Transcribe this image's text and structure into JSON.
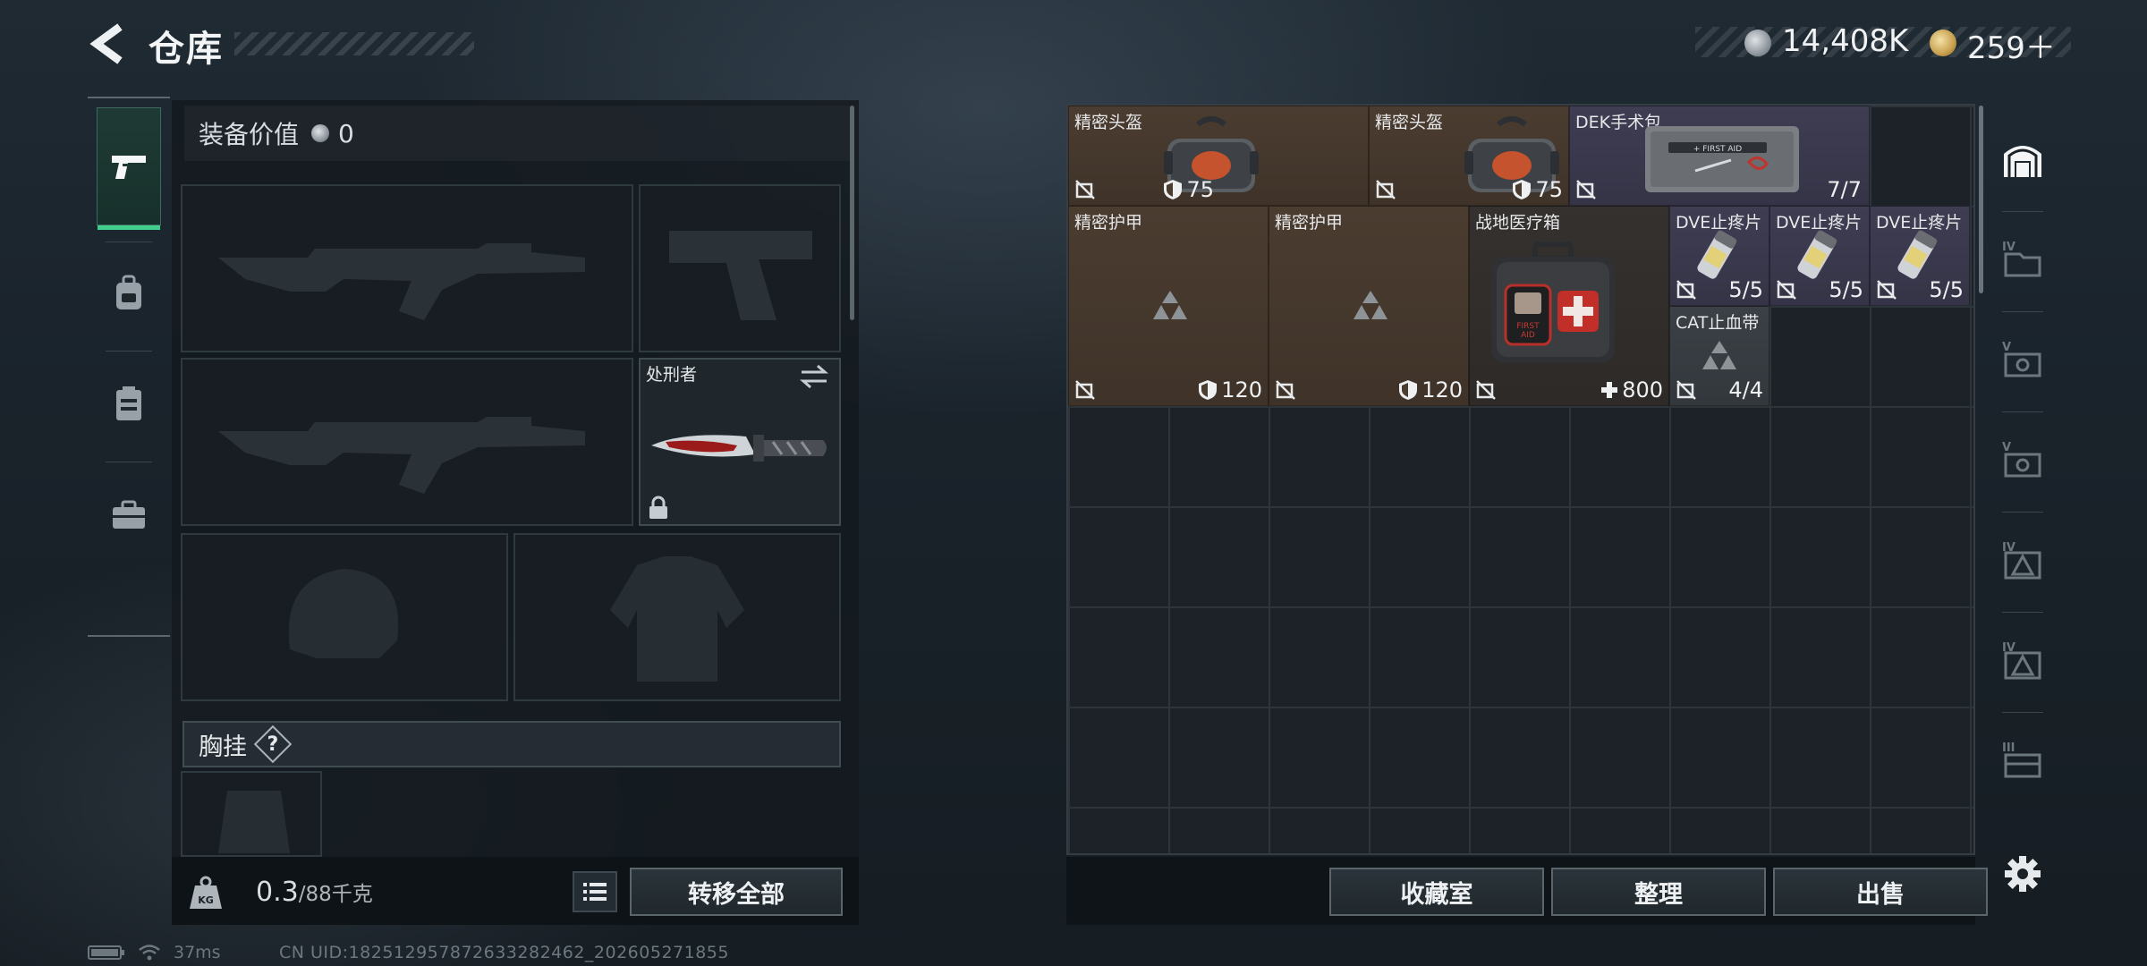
{
  "header": {
    "title": "仓库",
    "currency_silver": "14,408K",
    "currency_gold": "259＋"
  },
  "loadout": {
    "equip_value_label": "装备价值",
    "equip_value": "0",
    "knife_name": "处刑者",
    "chest_rig_label": "胸挂",
    "chest_rig_help": "?",
    "weight_current": "0.3",
    "weight_max": "/88千克",
    "transfer_all": "转移全部"
  },
  "stash": {
    "items": [
      {
        "name": "精密头盔",
        "stat": "75",
        "stat_icon": "shield-icon"
      },
      {
        "name": "精密头盔",
        "stat": "75",
        "stat_icon": "shield-icon"
      },
      {
        "name": "DEK手术包",
        "stat": "7/7"
      },
      {
        "name": "精密护甲",
        "stat": "120",
        "stat_icon": "shield-icon"
      },
      {
        "name": "精密护甲",
        "stat": "120",
        "stat_icon": "shield-icon"
      },
      {
        "name": "战地医疗箱",
        "stat": "800",
        "stat_icon": "plus-icon"
      },
      {
        "name": "DVE止疼片",
        "stat": "5/5"
      },
      {
        "name": "DVE止疼片",
        "stat": "5/5"
      },
      {
        "name": "DVE止疼片",
        "stat": "5/5"
      },
      {
        "name": "CAT止血带",
        "stat": "4/4"
      }
    ],
    "buttons": {
      "collection": "收藏室",
      "organize": "整理",
      "sell": "出售"
    }
  },
  "status": {
    "ping": "37ms",
    "uid": "CN UID:182512957872633282462_202605271855"
  },
  "colors": {
    "accent": "#41d08c",
    "item_brown": "#4b3c30",
    "item_purple": "#3f3d52"
  }
}
